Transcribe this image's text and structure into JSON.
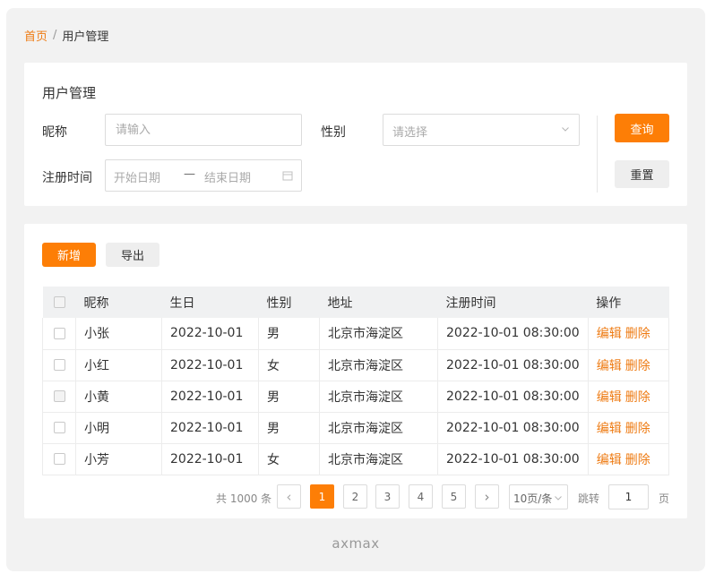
{
  "breadcrumb": {
    "home": "首页",
    "separator": "/",
    "current": "用户管理"
  },
  "search": {
    "title": "用户管理",
    "nickname_label": "昵称",
    "nickname_placeholder": "请输入",
    "gender_label": "性别",
    "gender_placeholder": "请选择",
    "register_label": "注册时间",
    "start_placeholder": "开始日期",
    "range_dash": "—",
    "end_placeholder": "结束日期",
    "query_label": "查询",
    "reset_label": "重置"
  },
  "toolbar": {
    "add_label": "新增",
    "export_label": "导出"
  },
  "table": {
    "headers": [
      "昵称",
      "生日",
      "性别",
      "地址",
      "注册时间",
      "操作"
    ],
    "edit_label": "编辑",
    "delete_label": "删除",
    "rows": [
      {
        "name": "小张",
        "birthday": "2022-10-01",
        "gender": "男",
        "address": "北京市海淀区",
        "registered": "2022-10-01 08:30:00"
      },
      {
        "name": "小红",
        "birthday": "2022-10-01",
        "gender": "女",
        "address": "北京市海淀区",
        "registered": "2022-10-01 08:30:00"
      },
      {
        "name": "小黄",
        "birthday": "2022-10-01",
        "gender": "男",
        "address": "北京市海淀区",
        "registered": "2022-10-01 08:30:00"
      },
      {
        "name": "小明",
        "birthday": "2022-10-01",
        "gender": "男",
        "address": "北京市海淀区",
        "registered": "2022-10-01 08:30:00"
      },
      {
        "name": "小芳",
        "birthday": "2022-10-01",
        "gender": "女",
        "address": "北京市海淀区",
        "registered": "2022-10-01 08:30:00"
      }
    ]
  },
  "pagination": {
    "total_text": "共 1000 条",
    "prev": "‹",
    "next": "›",
    "pages": [
      "1",
      "2",
      "3",
      "4",
      "5"
    ],
    "page_size": "10页/条",
    "jump_label": "跳转",
    "jump_value": "1",
    "page_unit": "页"
  },
  "footer": {
    "text": "axmax"
  },
  "colors": {
    "accent": "#fd7e06",
    "link": "#ee7b13",
    "page_bg": "#f2f2f2"
  }
}
